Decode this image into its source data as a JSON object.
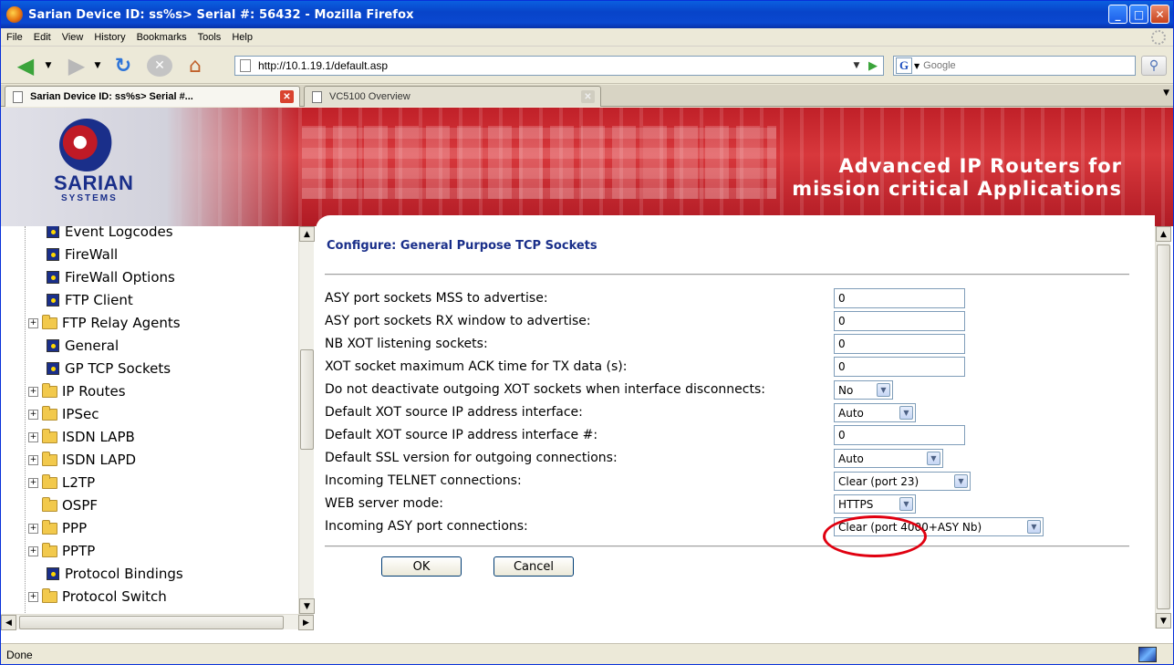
{
  "window": {
    "title": "Sarian Device ID: ss%s> Serial #: 56432 - Mozilla Firefox",
    "buttons": {
      "minimize": "_",
      "maximize": "□",
      "close": "✕"
    }
  },
  "menu": [
    "File",
    "Edit",
    "View",
    "History",
    "Bookmarks",
    "Tools",
    "Help"
  ],
  "toolbar": {
    "url": "http://10.1.19.1/default.asp",
    "search_placeholder": "Google",
    "search_engine": "G"
  },
  "tabs": [
    {
      "label": "Sarian Device ID: ss%s> Serial #...",
      "active": true
    },
    {
      "label": "VC5100 Overview",
      "active": false
    }
  ],
  "banner": {
    "logo_text": "SARIAN",
    "logo_sub": "SYSTEMS",
    "tagline_line1": "Advanced IP Routers for",
    "tagline_line2": "mission critical Applications"
  },
  "tree": {
    "items": [
      {
        "label": "Event Logcodes",
        "type": "doc"
      },
      {
        "label": "FireWall",
        "type": "doc"
      },
      {
        "label": "FireWall Options",
        "type": "doc"
      },
      {
        "label": "FTP Client",
        "type": "doc"
      },
      {
        "label": "FTP Relay Agents",
        "type": "folder",
        "expandable": true
      },
      {
        "label": "General",
        "type": "doc"
      },
      {
        "label": "GP TCP Sockets",
        "type": "doc",
        "selected": true
      },
      {
        "label": "IP Routes",
        "type": "folder",
        "expandable": true
      },
      {
        "label": "IPSec",
        "type": "folder",
        "expandable": true
      },
      {
        "label": "ISDN LAPB",
        "type": "folder",
        "expandable": true
      },
      {
        "label": "ISDN LAPD",
        "type": "folder",
        "expandable": true
      },
      {
        "label": "L2TP",
        "type": "folder",
        "expandable": true
      },
      {
        "label": "OSPF",
        "type": "folder",
        "expandable": false
      },
      {
        "label": "PPP",
        "type": "folder",
        "expandable": true
      },
      {
        "label": "PPTP",
        "type": "folder",
        "expandable": true
      },
      {
        "label": "Protocol Bindings",
        "type": "doc"
      },
      {
        "label": "Protocol Switch",
        "type": "folder",
        "expandable": true
      }
    ]
  },
  "form": {
    "title": "Configure: General Purpose TCP Sockets",
    "fields": [
      {
        "label": "ASY port sockets MSS to advertise:",
        "kind": "text",
        "value": "0"
      },
      {
        "label": "ASY port sockets RX window to advertise:",
        "kind": "text",
        "value": "0"
      },
      {
        "label": "NB XOT listening sockets:",
        "kind": "text",
        "value": "0"
      },
      {
        "label": "XOT socket maximum ACK time for TX data (s):",
        "kind": "text",
        "value": "0"
      },
      {
        "label": "Do not deactivate outgoing XOT sockets when interface disconnects:",
        "kind": "select",
        "value": "No"
      },
      {
        "label": "Default XOT source IP address interface:",
        "kind": "select",
        "value": "Auto"
      },
      {
        "label": "Default XOT source IP address interface #:",
        "kind": "text",
        "value": "0"
      },
      {
        "label": "Default SSL version for outgoing connections:",
        "kind": "select",
        "value": "Auto"
      },
      {
        "label": "Incoming TELNET connections:",
        "kind": "select",
        "value": "Clear (port 23)"
      },
      {
        "label": "WEB server mode:",
        "kind": "select",
        "value": "HTTPS",
        "highlighted": true
      },
      {
        "label": "Incoming ASY port connections:",
        "kind": "select",
        "value": "Clear (port 4000+ASY Nb)"
      }
    ],
    "ok_label": "OK",
    "cancel_label": "Cancel"
  },
  "status": {
    "text": "Done"
  },
  "colors": {
    "titlebar": "#0a48d0",
    "banner_red": "#c02028",
    "form_title": "#1a2f8a",
    "highlight_ring": "#e00010"
  }
}
